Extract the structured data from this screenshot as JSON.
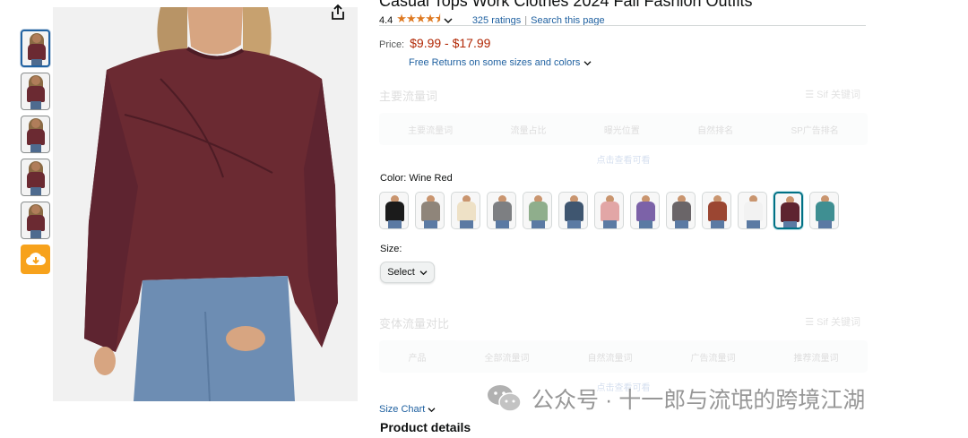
{
  "product": {
    "title_partial": "Casual Tops Work Clothes 2024 Fall Fashion Outfits",
    "rating_value": "4.4",
    "stars": "★★★★⯨",
    "ratings_count": "325 ratings",
    "separator": "|",
    "search_link": "Search this page",
    "price_label": "Price:",
    "price_value": "$9.99 - $17.99",
    "returns_text": "Free Returns on some sizes and colors"
  },
  "faded_panel_1": {
    "title": "主要流量词",
    "right_label": "☰ Sif 关键词",
    "columns": [
      "主要流量词",
      "流量占比",
      "曝光位置",
      "自然排名",
      "SP广告排名"
    ],
    "link": "点击查看可看"
  },
  "color": {
    "label": "Color: Wine Red",
    "swatches": [
      {
        "name": "Black",
        "hex": "#1b1b1b"
      },
      {
        "name": "Khaki Gray",
        "hex": "#8f857a"
      },
      {
        "name": "Apricot",
        "hex": "#eee1c6"
      },
      {
        "name": "Gray",
        "hex": "#7d7f82"
      },
      {
        "name": "Sage Green",
        "hex": "#8fae8c"
      },
      {
        "name": "Navy Blue",
        "hex": "#3f5670"
      },
      {
        "name": "Pink",
        "hex": "#e2a6a6"
      },
      {
        "name": "Purple",
        "hex": "#7c62a8"
      },
      {
        "name": "Dark Gray",
        "hex": "#6a6568"
      },
      {
        "name": "Brick Red",
        "hex": "#9b4632"
      },
      {
        "name": "White",
        "hex": "#f2f2f2"
      },
      {
        "name": "Wine Red",
        "hex": "#5e2430"
      },
      {
        "name": "Teal",
        "hex": "#3f8f92"
      }
    ],
    "selected_index": 11
  },
  "size": {
    "label": "Size:",
    "select_value": "Select"
  },
  "faded_panel_2": {
    "title": "变体流量对比",
    "right_label": "☰ Sif 关键词",
    "columns": [
      "产品",
      "全部流量词",
      "自然流量词",
      "广告流量词",
      "推荐流量词"
    ],
    "link": "点击查看可看"
  },
  "links": {
    "size_chart": "Size Chart",
    "product_details": "Product details"
  },
  "watermark": {
    "text": "公众号 · 十一郎与流氓的跨境江湖"
  },
  "colors": {
    "link_blue": "#2162a1",
    "price_red": "#b12704",
    "star_orange": "#de7921",
    "shirt_wine": "#6b2a32",
    "cloud_orange": "#f7a21c"
  }
}
